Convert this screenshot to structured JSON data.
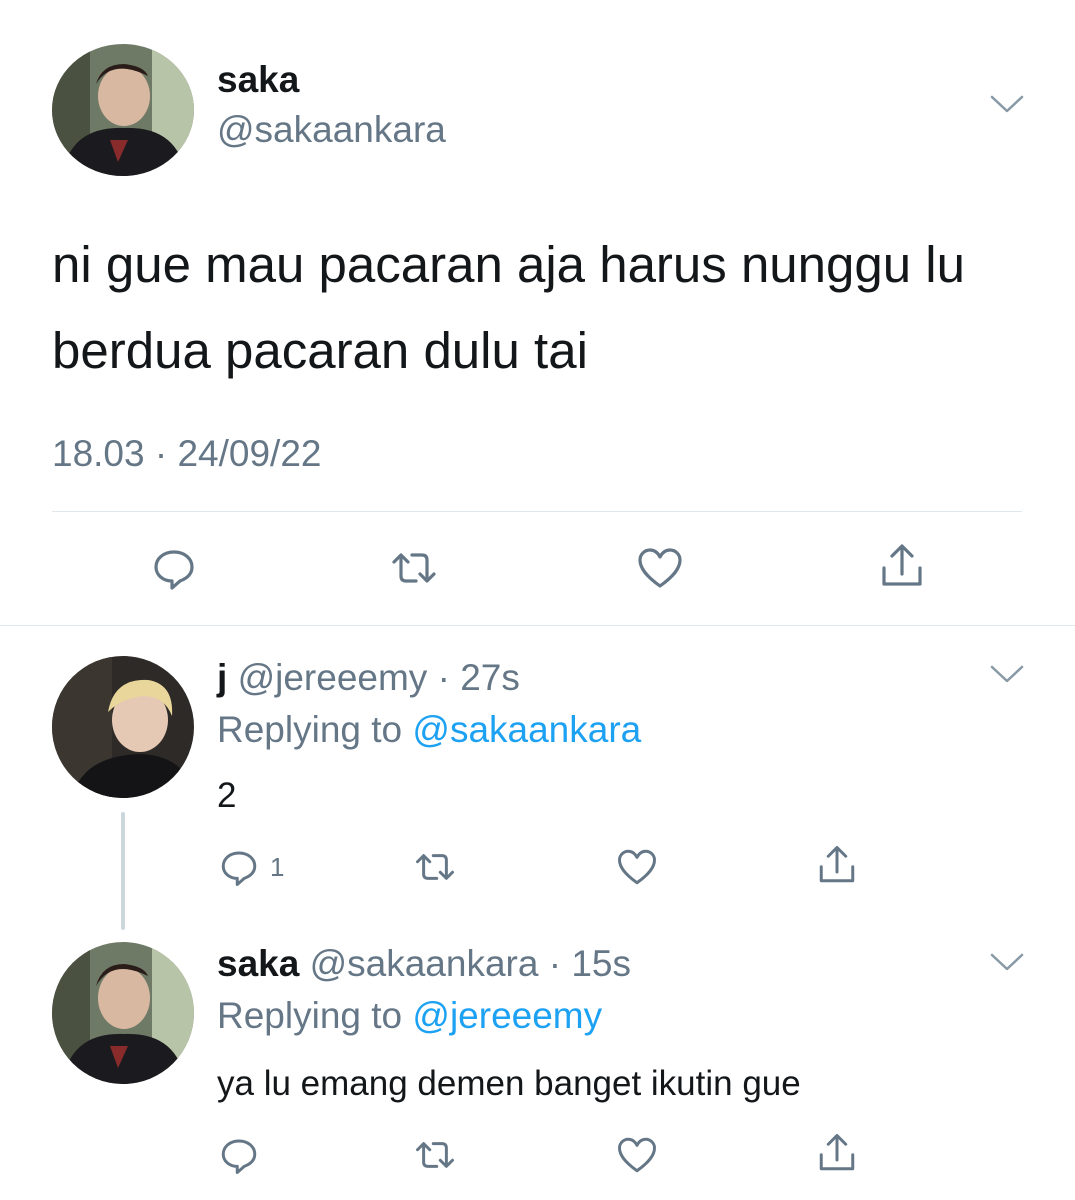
{
  "main_tweet": {
    "name": "saka",
    "handle": "@sakaankara",
    "text": "ni gue mau pacaran aja harus nunggu lu berdua pacaran dulu tai",
    "timestamp": "18.03 · 24/09/22",
    "actions": [
      "reply-icon",
      "retweet-icon",
      "like-icon",
      "share-icon"
    ]
  },
  "replies": [
    {
      "name": "j",
      "handle": "@jereeemy",
      "sep": "·",
      "time": "27s",
      "replying_label": "Replying to",
      "replying_to": "@sakaankara",
      "text": "2",
      "reply_count": "1"
    },
    {
      "name": "saka",
      "handle": "@sakaankara",
      "sep": "·",
      "time": "15s",
      "replying_label": "Replying to",
      "replying_to": "@jereeemy",
      "text": "ya lu emang demen banget ikutin gue"
    }
  ],
  "colors": {
    "text": "#14171a",
    "secondary": "#657786",
    "accent": "#1da1f2",
    "divider": "#e1e8ed",
    "thread_line": "#ccd6dd"
  }
}
